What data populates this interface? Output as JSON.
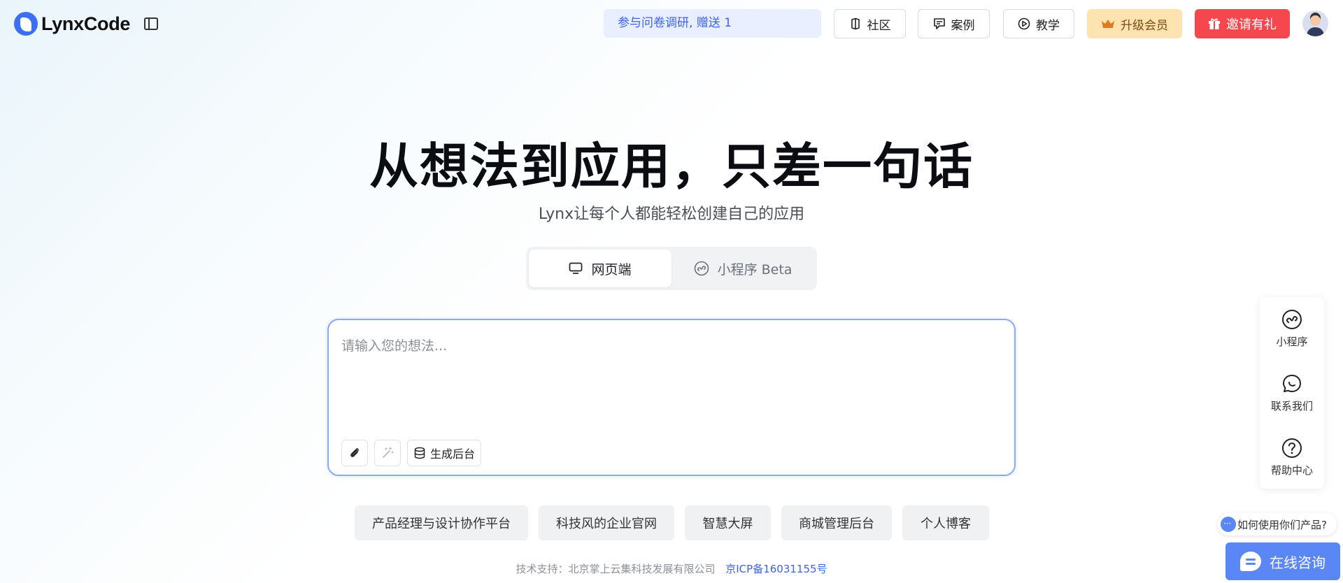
{
  "header": {
    "logo_text": "LynxCode",
    "survey_banner": "参与问卷调研, 赠送 1",
    "nav": [
      {
        "label": "社区",
        "icon": "book-icon"
      },
      {
        "label": "案例",
        "icon": "note-icon"
      },
      {
        "label": "教学",
        "icon": "play-circle-icon"
      }
    ],
    "upgrade_label": "升级会员",
    "invite_label": "邀请有礼"
  },
  "hero": {
    "title": "从想法到应用，只差一句话",
    "subtitle": "Lynx让每个人都能轻松创建自己的应用"
  },
  "platform_tabs": [
    {
      "label": "网页端",
      "active": true
    },
    {
      "label": "小程序 Beta",
      "active": false
    }
  ],
  "prompt": {
    "placeholder": "请输入您的想法...",
    "generate_backend_label": "生成后台"
  },
  "templates": [
    "产品经理与设计协作平台",
    "科技风的企业官网",
    "智慧大屏",
    "商城管理后台",
    "个人博客"
  ],
  "footer": {
    "support_text": "技术支持：北京掌上云集科技发展有限公司",
    "icp_text": "京ICP备16031155号"
  },
  "float_panel": [
    {
      "label": "小程序",
      "icon": "mini-program-icon"
    },
    {
      "label": "联系我们",
      "icon": "chat-bubble-icon"
    },
    {
      "label": "帮助中心",
      "icon": "help-circle-icon"
    }
  ],
  "help_bubble": "如何使用你们产品?",
  "online_chat": "在线咨询",
  "colors": {
    "accent": "#3d6ff5",
    "invite": "#f5474d",
    "upgrade_bg": "#fde3b0",
    "chat": "#5b86f5"
  }
}
